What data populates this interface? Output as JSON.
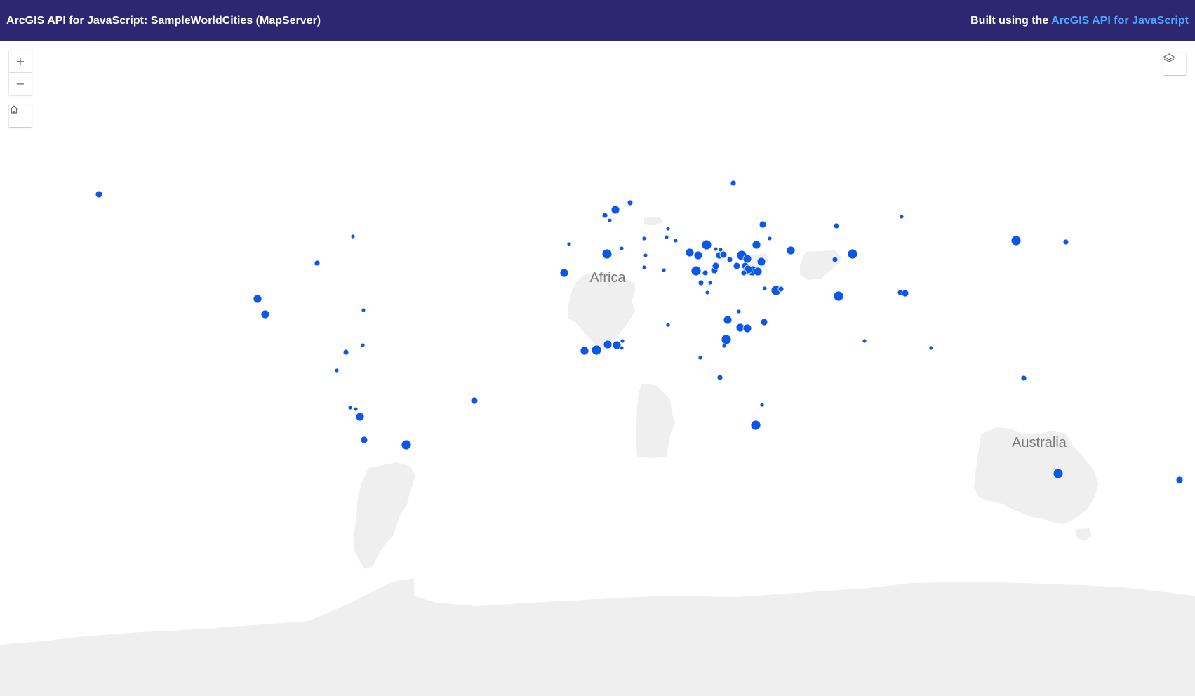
{
  "header": {
    "title": "ArcGIS API for JavaScript: SampleWorldCities (MapServer)",
    "credit_prefix": "Built using the ",
    "credit_link": "ArcGIS API for JavaScript"
  },
  "controls": {
    "zoom_in": "+",
    "zoom_out": "−",
    "home_icon": "home-icon",
    "layers_icon": "layer-list-icon"
  },
  "map": {
    "labels": {
      "africa": "Africa",
      "australia": "Australia"
    },
    "colors": {
      "land": "#efefef",
      "city": "#0b57e8",
      "header": "#2c2770",
      "link": "#4ca9ff"
    }
  }
}
